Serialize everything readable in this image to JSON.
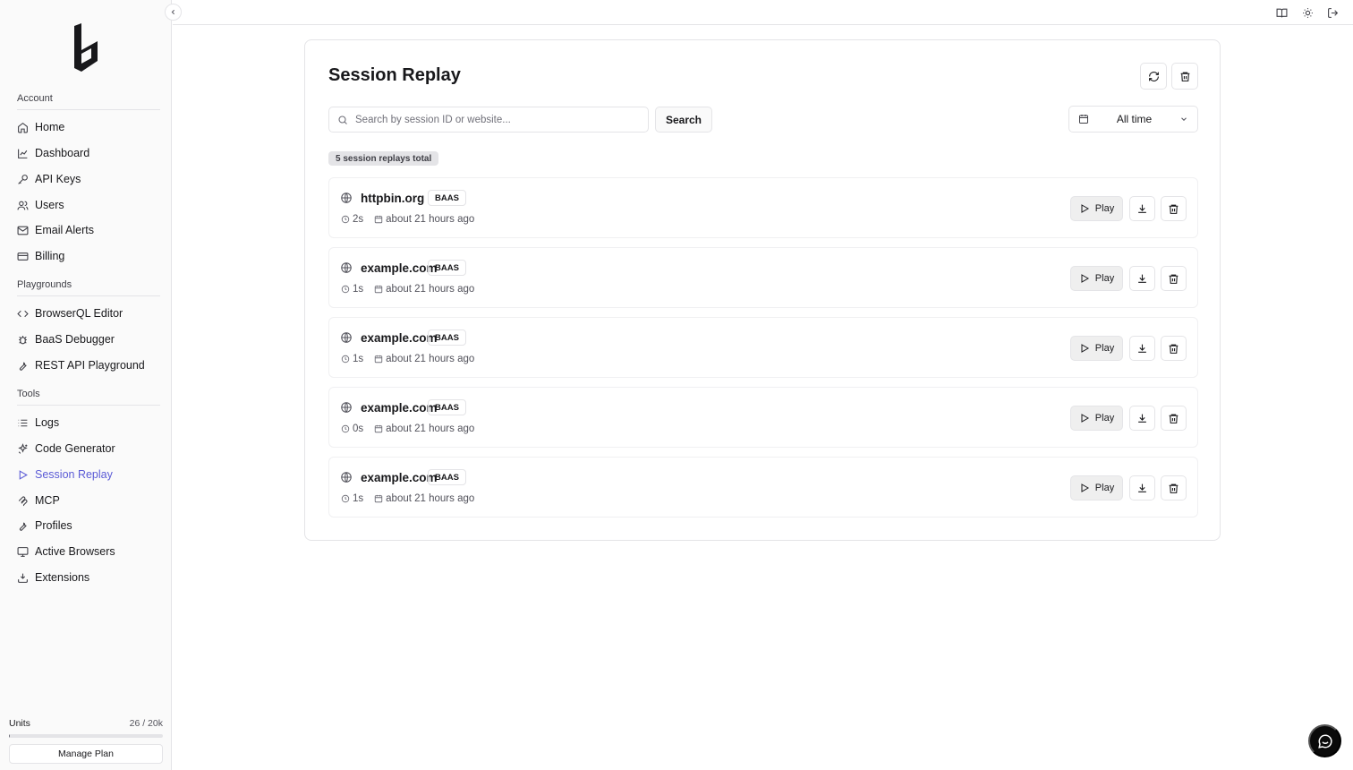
{
  "sidebar": {
    "sections": {
      "account": "Account",
      "playgrounds": "Playgrounds",
      "tools": "Tools"
    },
    "items": [
      {
        "label": "Home",
        "icon": "home-icon"
      },
      {
        "label": "Dashboard",
        "icon": "chart-line-icon"
      },
      {
        "label": "API Keys",
        "icon": "key-icon"
      },
      {
        "label": "Users",
        "icon": "users-icon"
      },
      {
        "label": "Email Alerts",
        "icon": "mail-icon"
      },
      {
        "label": "Billing",
        "icon": "credit-card-icon"
      },
      {
        "label": "BrowserQL Editor",
        "icon": "code-icon"
      },
      {
        "label": "BaaS Debugger",
        "icon": "bug-icon"
      },
      {
        "label": "REST API Playground",
        "icon": "wrench-icon"
      },
      {
        "label": "Logs",
        "icon": "list-icon"
      },
      {
        "label": "Code Generator",
        "icon": "sparkles-icon"
      },
      {
        "label": "Session Replay",
        "icon": "play-icon",
        "active": true
      },
      {
        "label": "MCP",
        "icon": "mcp-icon"
      },
      {
        "label": "Profiles",
        "icon": "wrench-icon"
      },
      {
        "label": "Active Browsers",
        "icon": "monitor-icon"
      },
      {
        "label": "Extensions",
        "icon": "extension-icon"
      }
    ],
    "units": {
      "label": "Units",
      "value": "26 / 20k",
      "fraction": 0.0013
    },
    "manage_plan": "Manage Plan"
  },
  "topbar": {
    "icons": [
      "book-icon",
      "sun-icon",
      "logout-icon"
    ]
  },
  "main": {
    "title": "Session Replay",
    "search": {
      "placeholder": "Search by session ID or website...",
      "value": "",
      "button": "Search"
    },
    "range": "All time",
    "total": "5 session replays total",
    "play_label": "Play",
    "sessions": [
      {
        "site": "httpbin.org",
        "tag": "BAAS",
        "duration": "2s",
        "when": "about 21 hours ago"
      },
      {
        "site": "example.com",
        "tag": "BAAS",
        "duration": "1s",
        "when": "about 21 hours ago"
      },
      {
        "site": "example.com",
        "tag": "BAAS",
        "duration": "1s",
        "when": "about 21 hours ago"
      },
      {
        "site": "example.com",
        "tag": "BAAS",
        "duration": "0s",
        "when": "about 21 hours ago"
      },
      {
        "site": "example.com",
        "tag": "BAAS",
        "duration": "1s",
        "when": "about 21 hours ago"
      }
    ]
  },
  "colors": {
    "accent": "#5b5bd6",
    "border": "#e4e4e7",
    "sidebar_bg": "#fafafa"
  }
}
